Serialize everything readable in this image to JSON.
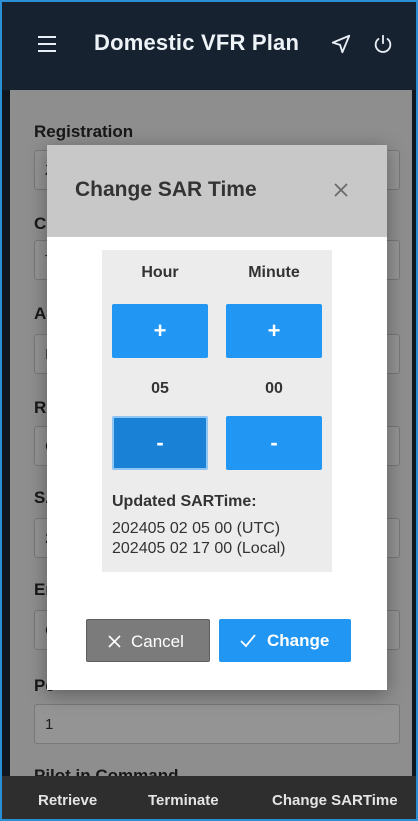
{
  "header": {
    "title": "Domestic VFR Plan"
  },
  "form": {
    "fields": [
      {
        "label": "Registration",
        "value": "Z"
      },
      {
        "label": "C",
        "value": "T"
      },
      {
        "label": "A",
        "value": "I"
      },
      {
        "label": "Re",
        "value": "C"
      },
      {
        "label": "SA",
        "value": "2"
      },
      {
        "label": "En",
        "value": "C"
      },
      {
        "label": "Pe",
        "value": "1"
      },
      {
        "label": "Pilot in Command"
      }
    ]
  },
  "dialog": {
    "title": "Change SAR Time",
    "hour_label": "Hour",
    "minute_label": "Minute",
    "plus": "+",
    "minus": "-",
    "hour_value": "05",
    "minute_value": "00",
    "updated_label": "Updated SARTime:",
    "utc_line": "202405 02 05 00 (UTC)",
    "local_line": "202405 02 17 00 (Local)",
    "cancel_label": "Cancel",
    "change_label": "Change"
  },
  "bottom": {
    "retrieve": "Retrieve",
    "terminate": "Terminate",
    "change_sar": "Change SARTime"
  },
  "colors": {
    "accent": "#2196f3",
    "header_bg": "#172230"
  }
}
